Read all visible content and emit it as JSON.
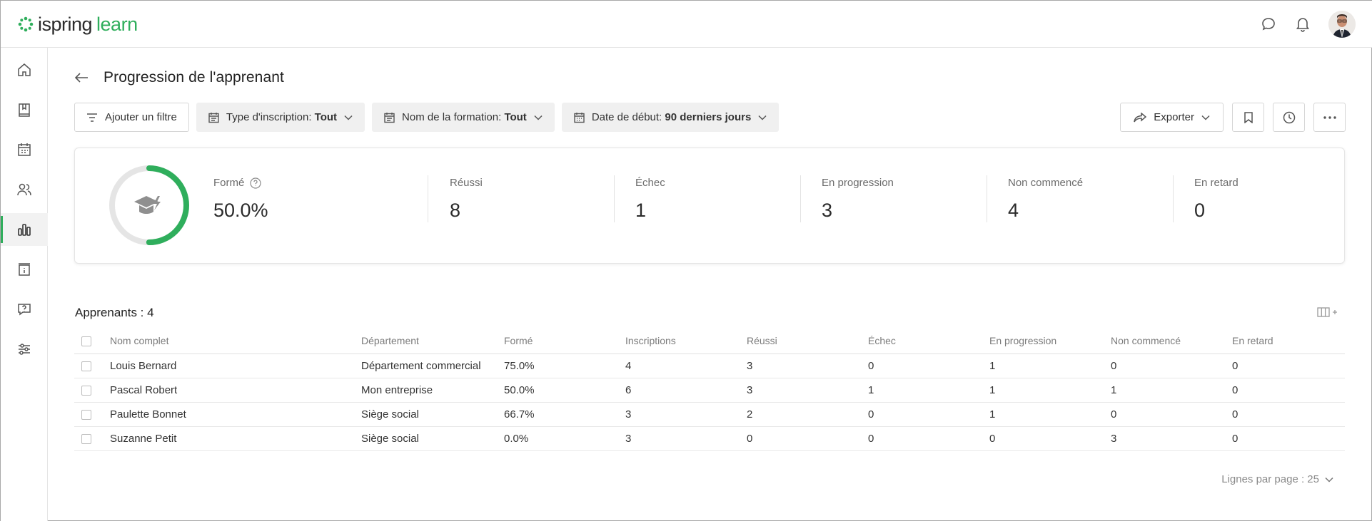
{
  "app": {
    "logo_left": "ispring",
    "logo_right": "learn"
  },
  "colors": {
    "accent": "#2fae5c",
    "ring_track": "#e5e5e5",
    "icon_grey": "#8a8a8a"
  },
  "header": {
    "icons": [
      "chat-icon",
      "bell-icon",
      "user-avatar"
    ]
  },
  "sidebar": {
    "items": [
      "home-icon",
      "book-icon",
      "calendar-icon",
      "users-icon",
      "reports-icon",
      "info-calendar-icon",
      "help-chat-icon",
      "settings-sliders-icon"
    ],
    "active_index": 4
  },
  "page": {
    "title": "Progression de l'apprenant"
  },
  "filters": {
    "add_filter": "Ajouter un filtre",
    "enrollment": {
      "label": "Type d'inscription:",
      "value": "Tout"
    },
    "course": {
      "label": "Nom de la formation:",
      "value": "Tout"
    },
    "start_date": {
      "label": "Date de début:",
      "value": "90 derniers jours"
    }
  },
  "actions": {
    "export": "Exporter"
  },
  "summary": {
    "trained": {
      "label": "Formé",
      "value": "50.0%",
      "fraction": 0.5
    },
    "passed": {
      "label": "Réussi",
      "value": "8"
    },
    "failed": {
      "label": "Échec",
      "value": "1"
    },
    "in_progress": {
      "label": "En progression",
      "value": "3"
    },
    "not_started": {
      "label": "Non commencé",
      "value": "4"
    },
    "overdue": {
      "label": "En retard",
      "value": "0"
    }
  },
  "table": {
    "title": "Apprenants : 4",
    "columns": [
      "Nom complet",
      "Département",
      "Formé",
      "Inscriptions",
      "Réussi",
      "Échec",
      "En progression",
      "Non commencé",
      "En retard"
    ],
    "rows": [
      [
        "Louis Bernard",
        "Département commercial",
        "75.0%",
        "4",
        "3",
        "0",
        "1",
        "0",
        "0"
      ],
      [
        "Pascal Robert",
        "Mon entreprise",
        "50.0%",
        "6",
        "3",
        "1",
        "1",
        "1",
        "0"
      ],
      [
        "Paulette Bonnet",
        "Siège social",
        "66.7%",
        "3",
        "2",
        "0",
        "1",
        "0",
        "0"
      ],
      [
        "Suzanne Petit",
        "Siège social",
        "0.0%",
        "3",
        "0",
        "0",
        "0",
        "3",
        "0"
      ]
    ]
  },
  "pagination": {
    "label": "Lignes par page : 25"
  }
}
